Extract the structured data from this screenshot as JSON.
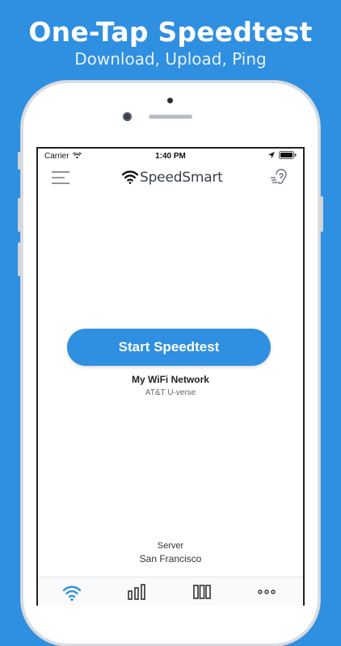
{
  "promo": {
    "headline": "One-Tap Speedtest",
    "subheadline": "Download, Upload, Ping"
  },
  "status_bar": {
    "carrier": "Carrier",
    "time": "1:40 PM"
  },
  "header": {
    "app_name": "SpeedSmart",
    "menu_icon": "hamburger-menu-icon",
    "logo_icon": "wifi-icon",
    "right_icon": "ear-icon"
  },
  "main": {
    "start_button_label": "Start Speedtest",
    "network_name": "My WiFi Network",
    "network_provider": "AT&T U-verse",
    "server_label": "Server",
    "server_value": "San Francisco"
  },
  "tabs": [
    {
      "icon": "wifi-icon",
      "active": true
    },
    {
      "icon": "bar-chart-icon",
      "active": false
    },
    {
      "icon": "columns-icon",
      "active": false
    },
    {
      "icon": "more-dots-icon",
      "active": false
    }
  ],
  "colors": {
    "background": "#2f8fe0",
    "accent": "#2f8fe0",
    "text_dark": "#222222"
  }
}
